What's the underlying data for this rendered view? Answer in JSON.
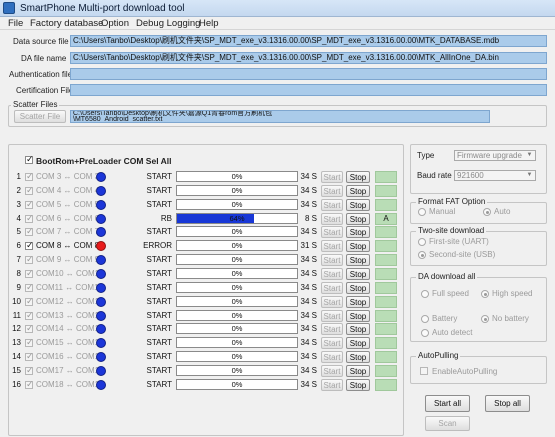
{
  "window": {
    "title": "SmartPhone Multi-port download tool"
  },
  "menu": [
    "File",
    "Factory database",
    "Option",
    "Debug Logging",
    "Help"
  ],
  "files": {
    "data_source_label": "Data source file",
    "data_source_value": "C:\\Users\\Tanbo\\Desktop\\刷机文件夹\\SP_MDT_exe_v3.1316.00.00\\SP_MDT_exe_v3.1316.00.00\\MTK_DATABASE.mdb",
    "da_label": "DA file name",
    "da_value": "C:\\Users\\Tanbo\\Desktop\\刷机文件夹\\SP_MDT_exe_v3.1316.00.00\\SP_MDT_exe_v3.1316.00.00\\MTK_AllInOne_DA.bin",
    "auth_label": "Authentication file",
    "cert_label": "Certification File"
  },
  "scatter": {
    "group_label": "Scatter Files",
    "button": "Scatter File",
    "line1": "C:\\Users\\Tanbo\\Desktop\\刷机文件夹\\嘉源Q1青春rom官方刷机包",
    "line2": "\\MT6580_Android_scatter.txt"
  },
  "bootrom_label": "BootRom+PreLoader COM Sel All",
  "ports": [
    {
      "num": "1",
      "label": "COM 3 ↔ COM 3",
      "checked": true,
      "enabled": false,
      "dot": "blue",
      "status": "START",
      "progress": 0,
      "progress_text": "0%",
      "time": "34 S",
      "result": ""
    },
    {
      "num": "2",
      "label": "COM 4 ↔ COM 4",
      "checked": true,
      "enabled": false,
      "dot": "blue",
      "status": "START",
      "progress": 0,
      "progress_text": "0%",
      "time": "34 S",
      "result": ""
    },
    {
      "num": "3",
      "label": "COM 5 ↔ COM 5",
      "checked": true,
      "enabled": false,
      "dot": "blue",
      "status": "START",
      "progress": 0,
      "progress_text": "0%",
      "time": "34 S",
      "result": ""
    },
    {
      "num": "4",
      "label": "COM 6 ↔ COM 6",
      "checked": true,
      "enabled": false,
      "dot": "blue",
      "status": "RB",
      "progress": 0.64,
      "progress_text": "64%",
      "time": "8 S",
      "result": "A"
    },
    {
      "num": "5",
      "label": "COM 7 ↔ COM 7",
      "checked": true,
      "enabled": false,
      "dot": "blue",
      "status": "START",
      "progress": 0,
      "progress_text": "0%",
      "time": "34 S",
      "result": ""
    },
    {
      "num": "6",
      "label": "COM 8 ↔ COM 8",
      "checked": true,
      "enabled": true,
      "dot": "red",
      "status": "ERROR",
      "progress": 0,
      "progress_text": "0%",
      "time": "31 S",
      "result": ""
    },
    {
      "num": "7",
      "label": "COM 9 ↔ COM 9",
      "checked": true,
      "enabled": false,
      "dot": "blue",
      "status": "START",
      "progress": 0,
      "progress_text": "0%",
      "time": "34 S",
      "result": ""
    },
    {
      "num": "8",
      "label": "COM10 ↔ COM10",
      "checked": true,
      "enabled": false,
      "dot": "blue",
      "status": "START",
      "progress": 0,
      "progress_text": "0%",
      "time": "34 S",
      "result": ""
    },
    {
      "num": "9",
      "label": "COM11 ↔ COM11",
      "checked": true,
      "enabled": false,
      "dot": "blue",
      "status": "START",
      "progress": 0,
      "progress_text": "0%",
      "time": "34 S",
      "result": ""
    },
    {
      "num": "10",
      "label": "COM12 ↔ COM12",
      "checked": true,
      "enabled": false,
      "dot": "blue",
      "status": "START",
      "progress": 0,
      "progress_text": "0%",
      "time": "34 S",
      "result": ""
    },
    {
      "num": "11",
      "label": "COM13 ↔ COM13",
      "checked": true,
      "enabled": false,
      "dot": "blue",
      "status": "START",
      "progress": 0,
      "progress_text": "0%",
      "time": "34 S",
      "result": ""
    },
    {
      "num": "12",
      "label": "COM14 ↔ COM14",
      "checked": true,
      "enabled": false,
      "dot": "blue",
      "status": "START",
      "progress": 0,
      "progress_text": "0%",
      "time": "34 S",
      "result": ""
    },
    {
      "num": "13",
      "label": "COM15 ↔ COM15",
      "checked": true,
      "enabled": false,
      "dot": "blue",
      "status": "START",
      "progress": 0,
      "progress_text": "0%",
      "time": "34 S",
      "result": ""
    },
    {
      "num": "14",
      "label": "COM16 ↔ COM16",
      "checked": true,
      "enabled": false,
      "dot": "blue",
      "status": "START",
      "progress": 0,
      "progress_text": "0%",
      "time": "34 S",
      "result": ""
    },
    {
      "num": "15",
      "label": "COM17 ↔ COM17",
      "checked": true,
      "enabled": false,
      "dot": "blue",
      "status": "START",
      "progress": 0,
      "progress_text": "0%",
      "time": "34 S",
      "result": ""
    },
    {
      "num": "16",
      "label": "COM18 ↔ COM18",
      "checked": true,
      "enabled": false,
      "dot": "blue",
      "status": "START",
      "progress": 0,
      "progress_text": "0%",
      "time": "34 S",
      "result": ""
    }
  ],
  "row_buttons": {
    "start": "Start",
    "stop": "Stop"
  },
  "right": {
    "type_label": "Type",
    "type_value": "Firmware upgrade",
    "baud_label": "Baud rate",
    "baud_value": "921600",
    "fat": {
      "title": "Format FAT Option",
      "opt1": "Manual",
      "opt2": "Auto",
      "selected": "Auto"
    },
    "twosite": {
      "title": "Two-site download",
      "opt1": "First-site (UART)",
      "opt2": "Second-site (USB)",
      "selected": "Second-site (USB)"
    },
    "da": {
      "title": "DA download all",
      "full": "Full speed",
      "high": "High speed",
      "battery": "Battery",
      "nobattery": "No battery",
      "auto": "Auto detect",
      "speed_selected": "High speed",
      "battery_selected": "No battery"
    },
    "autopull": {
      "title": "AutoPulling",
      "checkbox": "EnableAutoPulling"
    },
    "start_all": "Start all",
    "stop_all": "Stop all",
    "scan": "Scan"
  },
  "colors": {
    "progress": "#1837d6",
    "dot_blue": "#1c36d8",
    "dot_red": "#e81a1a",
    "path_bg": "#aacbea",
    "result_bg": "#b9ddb6"
  }
}
